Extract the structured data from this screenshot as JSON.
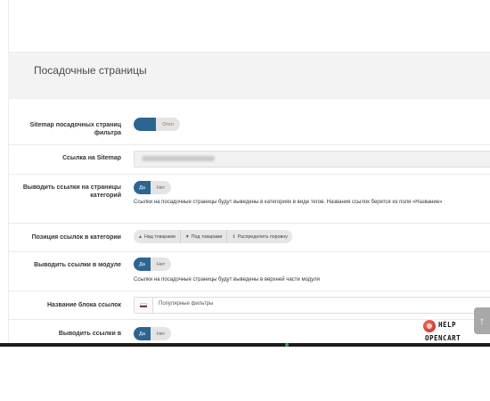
{
  "panel": {
    "title": "Посадочные страницы"
  },
  "rows": {
    "sitemap": {
      "label": "Sitemap посадочных страниц фильтра",
      "toggle_on": "",
      "toggle_off": "Откл"
    },
    "sitemap_link": {
      "label": "Ссылка на Sitemap"
    },
    "show_links_in_category": {
      "label": "Выводить ссылки на страницы категорий",
      "yes": "Да",
      "no": "Нет",
      "help": "Ссылки на посадочные страницы будут выведены в категориях в виде тегов. Названия ссылок берется из поля «Название»"
    },
    "links_position": {
      "label": "Позиция ссылок в категории",
      "options": [
        "Над товарами",
        "Под товарами",
        "Распределить поровну"
      ]
    },
    "show_links_in_module": {
      "label": "Выводить ссылки в модуле",
      "yes": "Да",
      "no": "Нет",
      "help": "Ссылки на посадочные страницы будут выведены в верхней части модуля"
    },
    "links_block_name": {
      "label": "Название блока ссылок",
      "value": "Популярные фильтры"
    },
    "show_links_in_filter": {
      "label": "Выводить ссылки в",
      "yes": "Да",
      "no": "Нет"
    }
  },
  "logo": {
    "line1": "HELP",
    "line2": "OPENCART"
  },
  "colors": {
    "accent": "#2c6590",
    "danger": "#d9534f"
  }
}
